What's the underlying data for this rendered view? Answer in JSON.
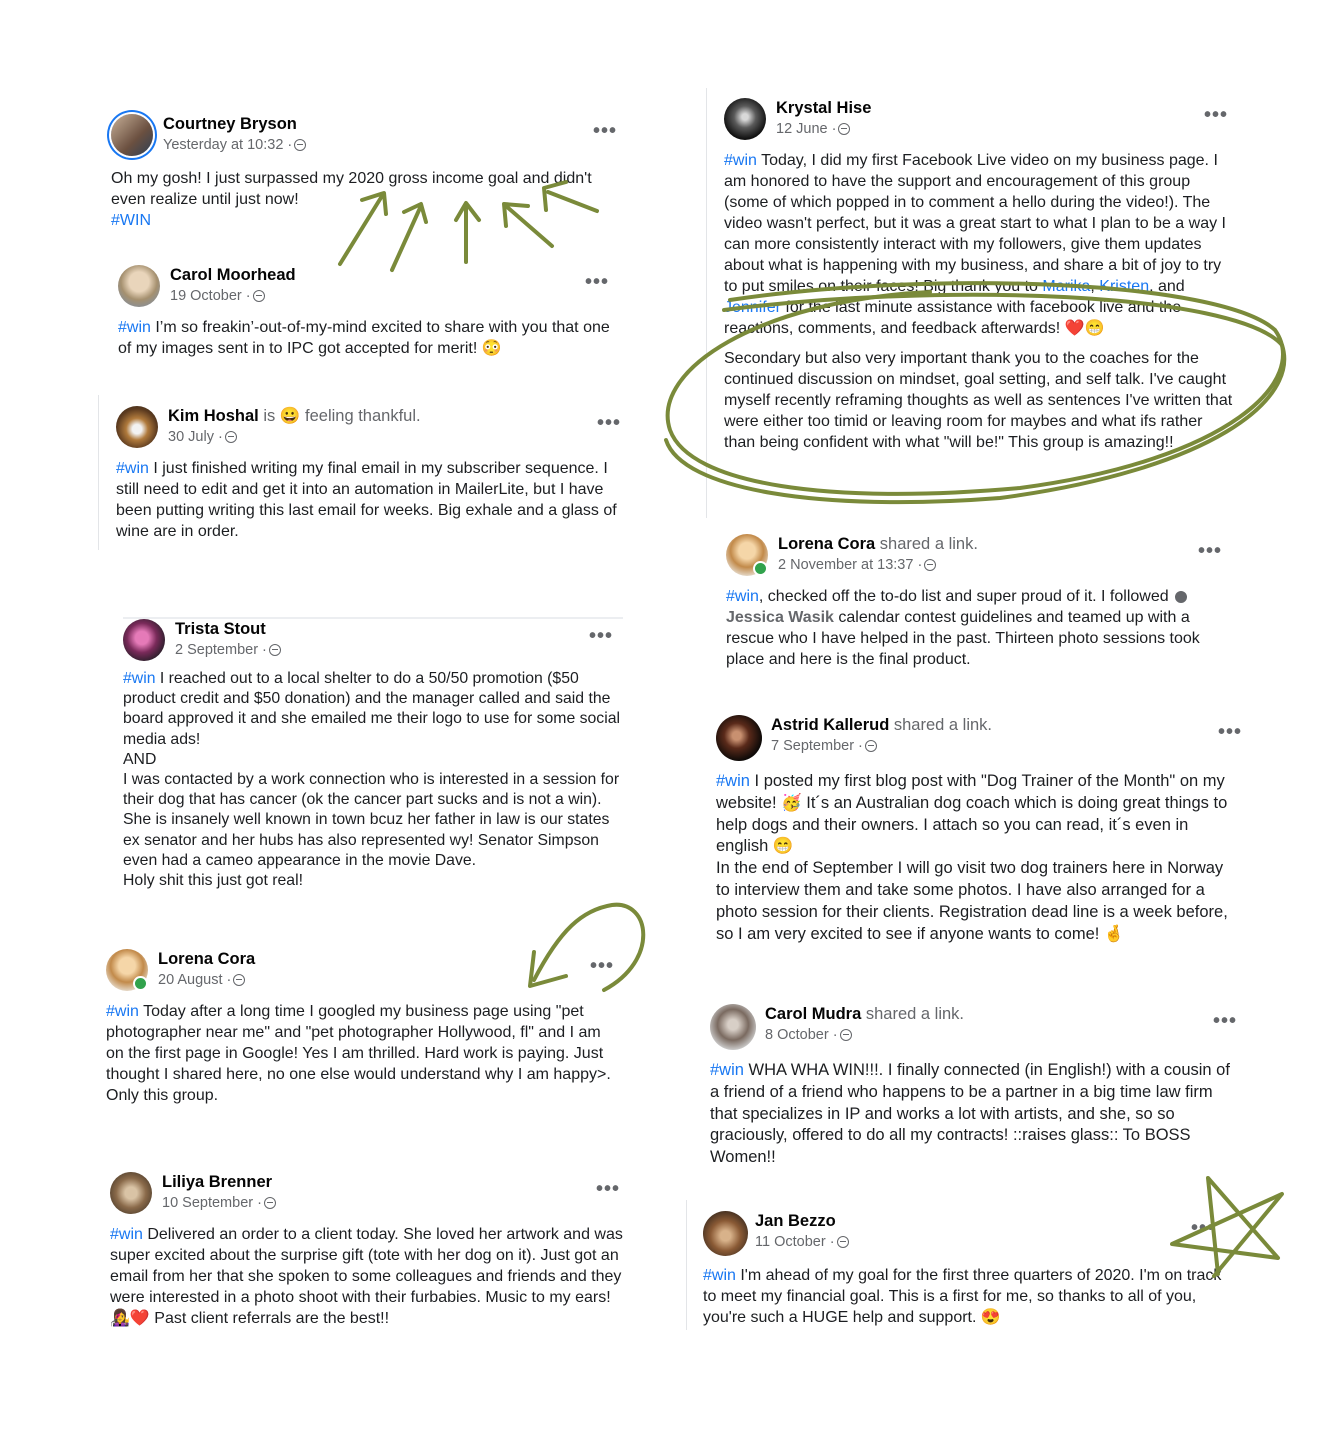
{
  "posts": [
    {
      "name": "Courtney Bryson",
      "action": "",
      "date": "Yesterday at 10:32 ·",
      "tag": "",
      "text": "Oh my gosh! I just surpassed my 2020 gross income goal and didn't even realize until just now!",
      "tag_after": "#WIN"
    },
    {
      "name": "Carol Moorhead",
      "action": "",
      "date": "19 October ·",
      "tag": "#win",
      "text": " I’m so freakin’-out-of-my-mind excited to share with you that one of my images sent in to IPC got accepted for merit! 😳"
    },
    {
      "name": "Kim Hoshal",
      "action": "is 😀 feeling thankful.",
      "date": "30 July ·",
      "tag": "#win",
      "text": " I just finished writing my final email in my subscriber sequence. I still need to edit and get it into an automation in MailerLite, but I have been putting writing this last email for weeks. Big exhale and a glass of wine are in order."
    },
    {
      "name": "Trista Stout",
      "action": "",
      "date": "2 September ·",
      "tag": "#win",
      "text": " I reached out to a local shelter to do a 50/50 promotion ($50 product credit and $50 donation) and the manager called and said the board approved it and she emailed me their logo to use for some social media ads!\nAND\nI was contacted by a work connection who is interested in a session for their dog that has cancer (ok the cancer part sucks and is not a win). She is insanely well known in town bcuz her father in law is our states ex senator and her hubs has also represented wy!  Senator Simpson even had a cameo appearance in the movie Dave.\nHoly shit this just got real!"
    },
    {
      "name": "Lorena Cora",
      "action": "",
      "date": "20 August ·",
      "tag": "#win",
      "text": " Today after a long time I googled my business page using \"pet photographer near me\" and \"pet photographer Hollywood, fl\" and I am on the first page in Google!  Yes I am thrilled.  Hard work is paying.  Just thought I shared here, no one else would understand why I am happy>. Only this group."
    },
    {
      "name": "Liliya Brenner",
      "action": "",
      "date": "10 September ·",
      "tag": "#win",
      "text": "  Delivered an order to a client today. She loved her artwork and was super excited about the surprise gift (tote with her dog on it). Just got an email from her that she spoken to some colleagues and friends and they were interested in a photo shoot with their furbabies. Music to my ears! 👩‍🎤❤️  Past client referrals are the best!!"
    },
    {
      "name": "Krystal Hise",
      "action": "",
      "date": "12 June ·",
      "tag": "#win",
      "text": " Today, I did my first Facebook Live video on my business page. I am honored to have the support and encouragement of this group (some of which popped in to comment a hello during the video!). The video wasn't perfect, but it was a great start to what I plan to be a way I can more consistently interact with my followers, give them updates about what is happening with my business, and share a bit of joy to try to put smiles on their faces! Big thank you to ",
      "link1": "Marika",
      "sep1": ", ",
      "link2": "Kristen",
      "sep2": ", and ",
      "link3": "Jennifer",
      "text_end": " for the last minute assistance with facebook live and the reactions, comments, and feedback afterwards! ❤️😁",
      "text2": "Secondary but also very important thank you to the coaches for the continued discussion on mindset, goal setting, and self talk.  I've caught myself recently reframing thoughts as well as sentences I've written that were either too timid or leaving room for maybes and what ifs rather than being confident with what \"will be!\" This group is amazing!!"
    },
    {
      "name": "Lorena Cora",
      "action": "shared a link.",
      "date": "2 November at 13:37 ·",
      "tag": "#win",
      "text": ", checked off the to-do list and super proud of it.  I followed ",
      "mention": "Jessica Wasik",
      "text_end": " calendar contest guidelines and teamed up with a rescue who I have helped in the past.  Thirteen photo sessions took place and here is the final product."
    },
    {
      "name": "Astrid Kallerud",
      "action": "shared a link.",
      "date": "7 September ·",
      "tag": "#win",
      "text": " I posted my first blog post with \"Dog Trainer of the Month\" on my website! 🥳  It´s an Australian dog coach which is doing great things to help dogs and their owners. I attach so you can read, it´s even in english 😁\nIn the end of September I will go visit two dog trainers here in Norway to interview them and take some photos. I have also arranged for a photo session for their clients. Registration dead line is a week before, so I am very excited to see if anyone wants to come! 🤞"
    },
    {
      "name": "Carol Mudra",
      "action": "shared a link.",
      "date": "8 October ·",
      "tag": "#win",
      "text": " WHA WHA WIN!!!. I finally connected (in English!) with a cousin of a friend of a friend who happens to be a partner in a big time law firm that specializes in IP and works a lot with artists, and she, so so graciously, offered to do all my contracts! ::raises glass:: To BOSS Women!!"
    },
    {
      "name": "Jan Bezzo",
      "action": "",
      "date": "11 October ·",
      "tag": "#win",
      "text": " I'm ahead of my goal for the first three quarters of 2020. I'm on track to meet my financial goal. This is a first for me, so thanks to all of you, you're such a HUGE help and support. 😍"
    }
  ],
  "more_label": "•••",
  "colors": {
    "accent": "#1877f2",
    "doodle": "#7a8a3a",
    "meta": "#65676b"
  },
  "icons": [
    "more-options-icon",
    "globe-icon",
    "avatar"
  ]
}
